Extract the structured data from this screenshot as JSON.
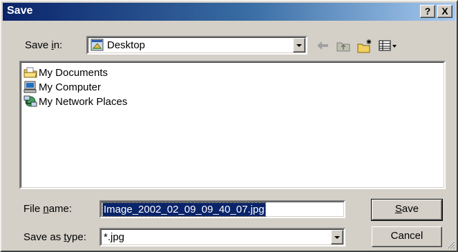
{
  "window": {
    "title": "Save"
  },
  "title_buttons": {
    "help": "?",
    "close": "X"
  },
  "save_in": {
    "label_before": "Save ",
    "label_accel": "i",
    "label_after": "n:",
    "value": "Desktop"
  },
  "toolbar": {
    "icons": [
      "back-arrow-icon",
      "up-folder-icon",
      "new-folder-icon",
      "view-menu-icon"
    ]
  },
  "file_list": {
    "items": [
      {
        "label": "My Documents",
        "icon": "my-documents-icon"
      },
      {
        "label": "My Computer",
        "icon": "my-computer-icon"
      },
      {
        "label": "My Network Places",
        "icon": "network-places-icon"
      }
    ]
  },
  "file_name": {
    "label_before": "File ",
    "label_accel": "n",
    "label_after": "ame:",
    "value": "Image_2002_02_09_09_40_07.jpg"
  },
  "save_as_type": {
    "label_before": "Save as ",
    "label_accel": "t",
    "label_after": "ype:",
    "value": "*.jpg"
  },
  "buttons": {
    "save_accel": "S",
    "save_rest": "ave",
    "cancel": "Cancel"
  },
  "colors": {
    "dialog_face": "#d4d0c8",
    "title_gradient_start": "#0a246a",
    "title_gradient_end": "#a6caf0",
    "selection": "#0a246a"
  }
}
